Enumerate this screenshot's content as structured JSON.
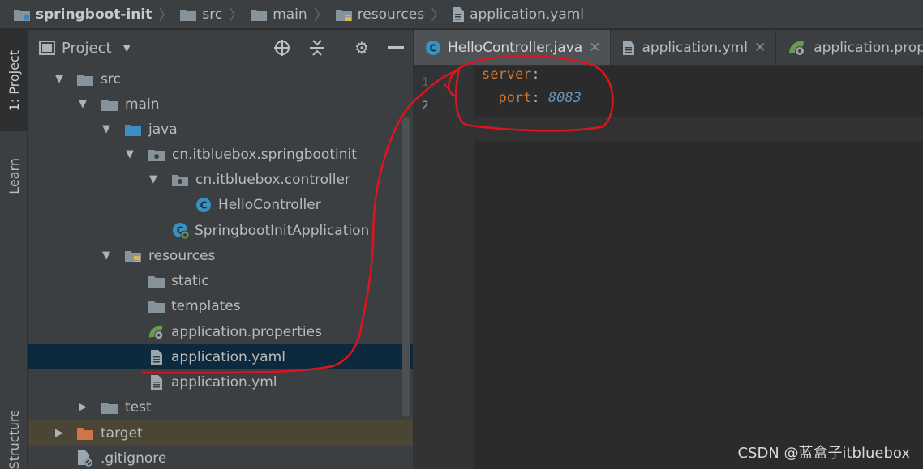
{
  "breadcrumb": {
    "items": [
      "springboot-init",
      "src",
      "main",
      "resources",
      "application.yaml"
    ]
  },
  "tool_strip": {
    "project_tab": "1: Project",
    "learn_tab": "Learn",
    "structure_tab": "Structure"
  },
  "project_panel": {
    "title": "Project",
    "tree": [
      {
        "label": "src",
        "icon": "folder-icon",
        "expanded": true
      },
      {
        "label": "main",
        "icon": "folder-icon",
        "expanded": true
      },
      {
        "label": "java",
        "icon": "source-folder-icon",
        "expanded": true
      },
      {
        "label": "cn.itbluebox.springbootinit",
        "icon": "package-icon",
        "expanded": true
      },
      {
        "label": "cn.itbluebox.controller",
        "icon": "package-icon",
        "expanded": true
      },
      {
        "label": "HelloController",
        "icon": "class-icon"
      },
      {
        "label": "SpringbootInitApplication",
        "icon": "spring-boot-class-icon"
      },
      {
        "label": "resources",
        "icon": "resources-folder-icon",
        "expanded": true
      },
      {
        "label": "static",
        "icon": "folder-icon"
      },
      {
        "label": "templates",
        "icon": "folder-icon"
      },
      {
        "label": "application.properties",
        "icon": "spring-config-icon"
      },
      {
        "label": "application.yaml",
        "icon": "file-icon",
        "selected": true
      },
      {
        "label": "application.yml",
        "icon": "file-icon"
      },
      {
        "label": "test",
        "icon": "folder-icon",
        "expanded": false
      },
      {
        "label": "target",
        "icon": "excluded-folder-icon",
        "expanded": false
      },
      {
        "label": ".gitignore",
        "icon": "gitignore-file-icon"
      }
    ]
  },
  "editor": {
    "tabs": [
      {
        "label": "HelloController.java",
        "icon": "class-icon",
        "active": true
      },
      {
        "label": "application.yml",
        "icon": "file-icon"
      },
      {
        "label": "application.proper",
        "icon": "spring-config-icon"
      }
    ],
    "line_numbers": [
      "1",
      "2"
    ],
    "code": {
      "line1_key": "server",
      "line1_colon": ":",
      "line2_indent": "  ",
      "line2_key": "port",
      "line2_colon": ": ",
      "line2_value": "8083"
    }
  },
  "watermark": "CSDN @蓝盒子itbluebox",
  "colors": {
    "panel_bg": "#3c3f41",
    "editor_bg": "#2b2b2b",
    "selection": "#0d293e",
    "yaml_key": "#cc7832",
    "yaml_number": "#6897bb",
    "annotation_red": "#e0141c"
  }
}
